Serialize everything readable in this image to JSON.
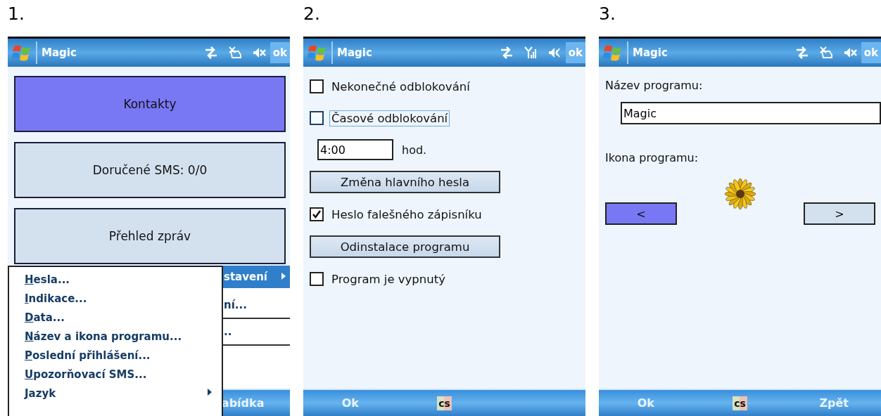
{
  "screens": [
    {
      "number": "1.",
      "title": "Magic",
      "status_icons": [
        {
          "kind": "sync"
        },
        {
          "kind": "signal-off"
        },
        {
          "kind": "speaker-muted"
        }
      ],
      "ok_button": "ok",
      "content": {
        "kind": "menu-buttons",
        "buttons": [
          {
            "label": "Kontakty",
            "selected": true
          },
          {
            "label": "Doručené SMS: 0/0",
            "selected": false
          },
          {
            "label": "Přehled zpráv",
            "selected": false
          }
        ]
      },
      "parent_menu": [
        {
          "label": "stavení",
          "selected": true,
          "submenu": true
        },
        {
          "label": "ní...",
          "selected": false,
          "submenu": false
        },
        {
          "label": "..",
          "selected": false,
          "submenu": false
        }
      ],
      "menu": [
        {
          "label": "Hesla...",
          "submenu": false
        },
        {
          "label": "Indikace...",
          "submenu": false
        },
        {
          "label": "Data...",
          "submenu": false
        },
        {
          "label": "Název a ikona programu...",
          "submenu": false
        },
        {
          "label": "Poslední přihlášení...",
          "submenu": false
        },
        {
          "label": "Upozorňovací SMS...",
          "submenu": false
        },
        {
          "label": "Jazyk",
          "submenu": true
        }
      ],
      "softkeys": {
        "right": "abídka"
      }
    },
    {
      "number": "2.",
      "title": "Magic",
      "status_icons": [
        {
          "kind": "sync"
        },
        {
          "kind": "signal"
        },
        {
          "kind": "speaker"
        }
      ],
      "ok_button": "ok",
      "content": {
        "kind": "form",
        "controls": [
          {
            "kind": "checkbox",
            "label": "Nekonečné odblokování",
            "checked": false,
            "focused": false
          },
          {
            "kind": "checkbox",
            "label": "Časové odblokování",
            "checked": false,
            "focused": true
          },
          {
            "kind": "field",
            "value": "4:00",
            "unit": "hod."
          },
          {
            "kind": "button",
            "label": "Změna hlavního hesla"
          },
          {
            "kind": "checkbox",
            "label": "Heslo falešného zápisníku",
            "checked": true,
            "focused": false
          },
          {
            "kind": "button",
            "label": "Odinstalace programu"
          },
          {
            "kind": "checkbox",
            "label": "Program je vypnutý",
            "checked": false,
            "focused": false
          }
        ]
      },
      "softkeys": {
        "left": "Ok",
        "input": "cs"
      }
    },
    {
      "number": "3.",
      "title": "Magic",
      "status_icons": [
        {
          "kind": "sync"
        },
        {
          "kind": "signal-off"
        },
        {
          "kind": "speaker-muted"
        }
      ],
      "ok_button": "ok",
      "content": {
        "kind": "name-icon",
        "name_label": "Název programu:",
        "name_value": "Magic",
        "icon_label": "Ikona programu:",
        "nav_buttons": [
          {
            "label": "<",
            "selected": true
          },
          {
            "label": ">",
            "selected": false
          }
        ]
      },
      "softkeys": {
        "left": "Ok",
        "input": "cs",
        "right": "Zpět"
      }
    }
  ]
}
